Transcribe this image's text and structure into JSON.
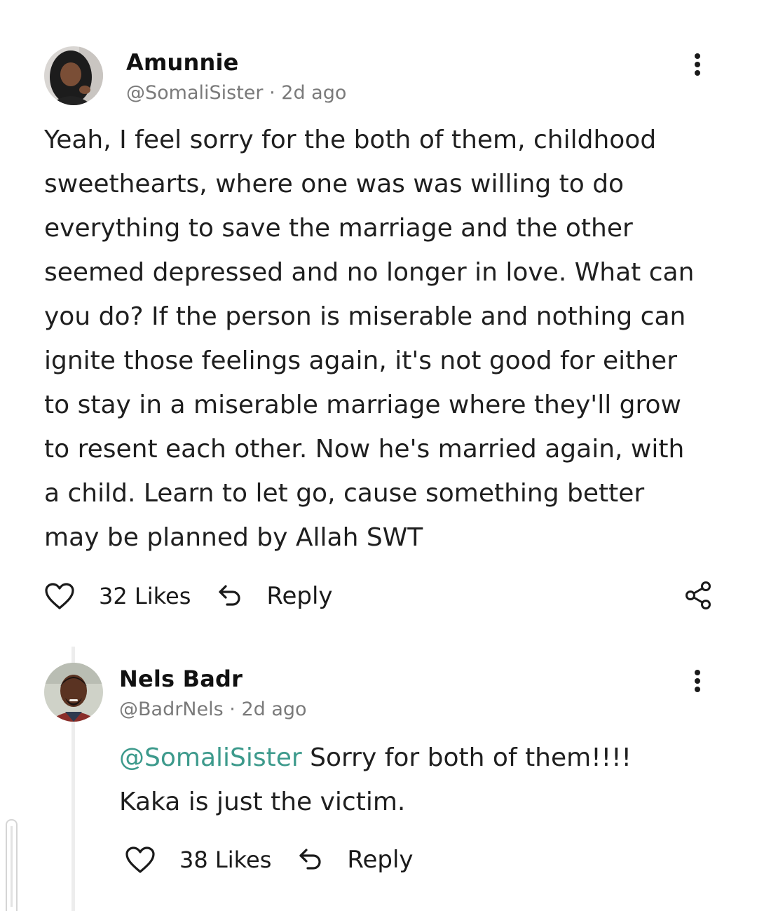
{
  "comment": {
    "author_name": "Amunnie",
    "author_handle": "@SomaliSister",
    "time_ago": "· 2d ago",
    "lines": [
      "Yeah, I feel sorry for the both of them, childhood",
      "sweethearts, where one was was willing to do",
      "everything to save the marriage and the other",
      "seemed depressed and no longer in love. What can",
      "you do? If the person is miserable and nothing can",
      "ignite those feelings again, it's not good for either",
      "to stay in a miserable marriage where they'll grow",
      "to resent each other. Now he's married again, with",
      "a child. Learn to let go, cause something better",
      "may be planned by Allah SWT"
    ],
    "likes": "32 Likes",
    "reply_label": "Reply"
  },
  "reply": {
    "author_name": "Nels Badr",
    "author_handle": "@BadrNels",
    "time_ago": "· 2d ago",
    "mention": "@SomaliSister",
    "line1_rest": " Sorry for both of them!!!!",
    "line2": "Kaka is just the victim.",
    "likes": "38 Likes",
    "reply_label": "Reply"
  },
  "icons": {
    "more": "more-vertical-icon",
    "like": "heart-icon",
    "reply": "reply-arrow-icon",
    "share": "share-icon"
  },
  "colors": {
    "mention": "#3d9a8c",
    "meta": "#7a7a7a",
    "text": "#1f1f1f"
  }
}
